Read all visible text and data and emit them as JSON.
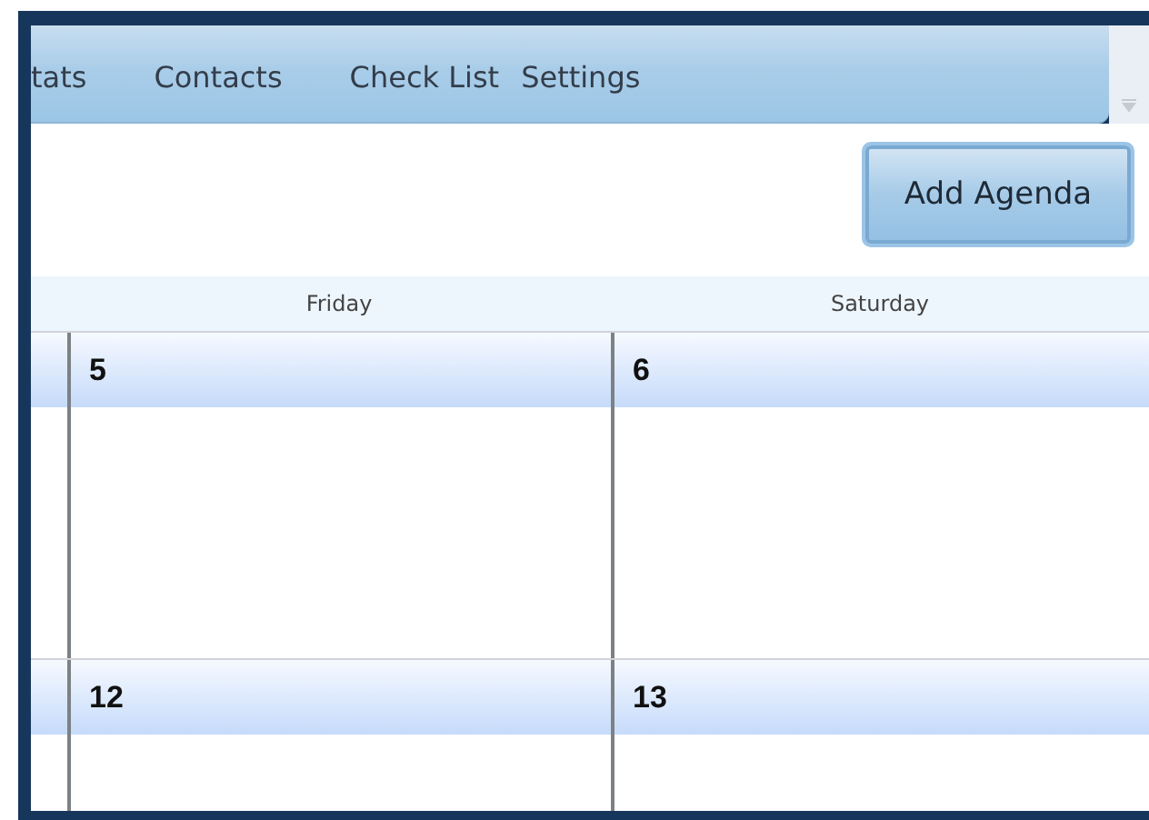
{
  "tabs": [
    {
      "label": "tats"
    },
    {
      "label": "Contacts"
    },
    {
      "label": "Check List"
    },
    {
      "label": "Settings"
    }
  ],
  "toolbar": {
    "button": "Add Agenda"
  },
  "calendar": {
    "day_headers": [
      "Friday",
      "Saturday"
    ],
    "weeks": [
      {
        "days": [
          "5",
          "6"
        ]
      },
      {
        "days": [
          "12",
          "13"
        ]
      }
    ]
  }
}
